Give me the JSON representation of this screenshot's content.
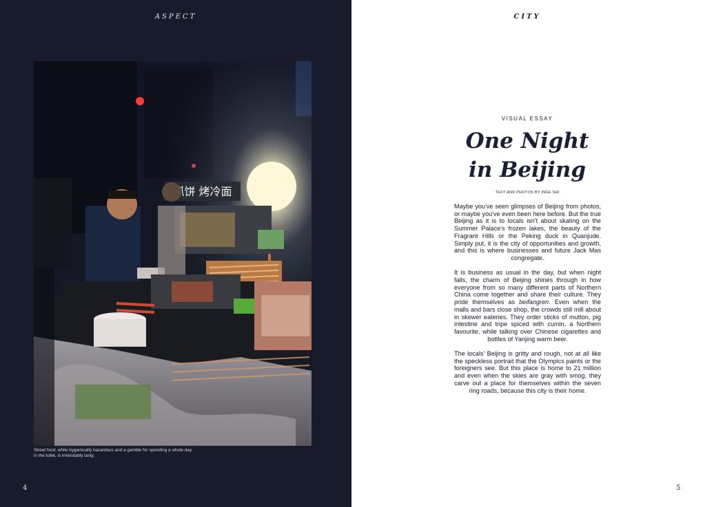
{
  "left_page": {
    "running_head": "ASPECT",
    "photo": {
      "sign_text": "抓饼 烤冷面",
      "colors": {
        "lamp": "#fbf4c8",
        "night": "#0b0c12",
        "skewer": "#c98a4e"
      }
    },
    "caption": "Street food, while hygienically hazardous and a gamble for spending a whole day in the toilet, is irresistably tasty.",
    "page_number": "4"
  },
  "right_page": {
    "running_head": "CITY",
    "kicker": "VISUAL ESSAY",
    "title_line1": "One Night",
    "title_line2": "in Beijing",
    "byline": "TEXT AND PHOTOS BY INGE SHI",
    "paragraphs": [
      "Maybe you've seen glimpses of Beijing from photos, or maybe you've even been here before. But the true Beijing as it is to locals isn't about skating on the Summer Palace's frozen lakes, the beauty of the Fragrant Hills or the Peking duck in Quanjude. Simply put, it is the city of opportunities and growth, and this is where businesses and future Jack Mas congregate.",
      "It is business as usual in the day, but when night falls, the charm of Beijing shines through in how everyone from so many different parts of Northern China come together and share their culture. They pride themselves as ",
      "beifangren",
      ". Even when the malls and bars close shop, the crowds still mill about in skewer eateries. They order sticks of mutton, pig intestine and tripe spiced with cumin, a Northern favourite, while talking over Chinese cigarettes and bottles of Yanjing warm beer.",
      "The locals' Beijing is gritty and rough, not at all like the speckless portrait that the Olympics paints or the foreigners see. But this place is home to 21 million and even when the skies are gray with smog, they carve out a place for themselves within the seven ring roads, because this city is their home."
    ],
    "page_number": "5"
  },
  "colors": {
    "navy": "#171b2c",
    "ink": "#1b1f33",
    "paper": "#ffffff"
  }
}
